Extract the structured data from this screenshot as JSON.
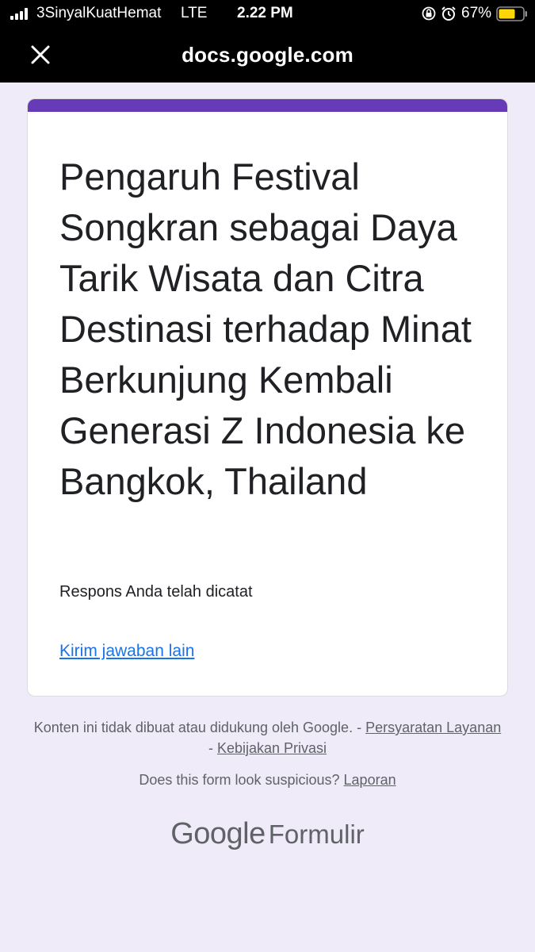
{
  "status_bar": {
    "carrier": "3SinyalKuatHemat",
    "network": "LTE",
    "time": "2.22 PM",
    "battery": "67%"
  },
  "browser": {
    "url": "docs.google.com",
    "close_icon": "close-icon"
  },
  "form": {
    "accent_color": "#673ab7",
    "title": "Pengaruh Festival Songkran sebagai Daya Tarik Wisata dan Citra Destinasi terhadap Minat Berkunjung Kembali Generasi Z Indonesia ke Bangkok, Thailand",
    "confirmation": "Respons Anda telah dicatat",
    "submit_another": "Kirim jawaban lain"
  },
  "footer": {
    "disclaimer_text": "Konten ini tidak dibuat atau didukung oleh Google.",
    "separator": "-",
    "terms_link": "Persyaratan Layanan",
    "privacy_link": "Kebijakan Privasi",
    "suspicious_text": "Does this form look suspicious?",
    "report_link": "Laporan",
    "brand_google": "Google",
    "brand_forms": "Formulir"
  }
}
